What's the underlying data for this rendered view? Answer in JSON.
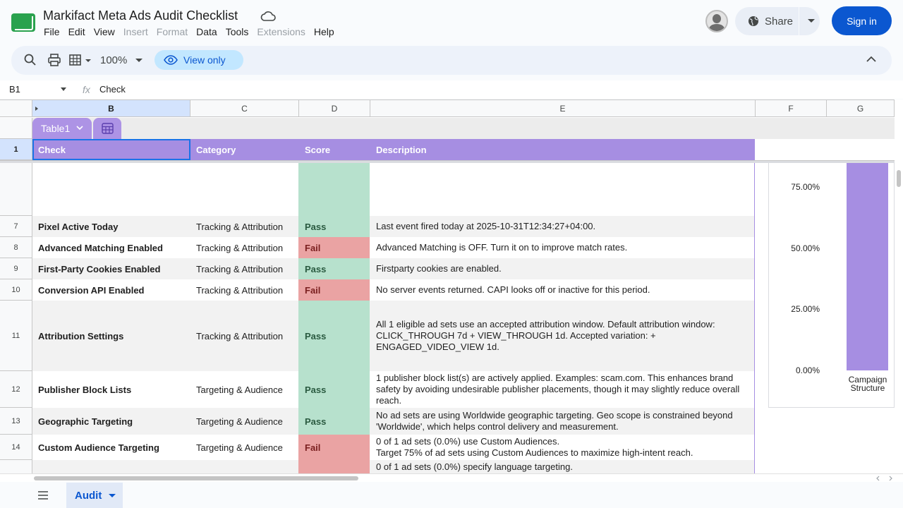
{
  "app": {
    "doc_title": "Markifact Meta Ads Audit Checklist",
    "menu": [
      {
        "label": "File",
        "enabled": true
      },
      {
        "label": "Edit",
        "enabled": true
      },
      {
        "label": "View",
        "enabled": true
      },
      {
        "label": "Insert",
        "enabled": false
      },
      {
        "label": "Format",
        "enabled": false
      },
      {
        "label": "Data",
        "enabled": true
      },
      {
        "label": "Tools",
        "enabled": true
      },
      {
        "label": "Extensions",
        "enabled": false
      },
      {
        "label": "Help",
        "enabled": true
      }
    ],
    "share_label": "Share",
    "signin_label": "Sign in"
  },
  "toolbar": {
    "zoom": "100%",
    "view_only": "View only"
  },
  "formula_bar": {
    "name_box": "B1",
    "fx": "fx",
    "value": "Check"
  },
  "grid": {
    "columns": [
      "B",
      "C",
      "D",
      "E",
      "F",
      "G"
    ],
    "table_name": "Table1",
    "header_row_number": "1",
    "headers": {
      "check": "Check",
      "category": "Category",
      "score": "Score",
      "description": "Description"
    },
    "rows": [
      {
        "num": "",
        "check": "",
        "category": "",
        "score": "",
        "status": "pass",
        "description": ""
      },
      {
        "num": "7",
        "check": "Pixel Active Today",
        "category": "Tracking & Attribution",
        "score": "Pass",
        "status": "pass",
        "description": "Last event fired today at 2025-10-31T12:34:27+04:00."
      },
      {
        "num": "8",
        "check": "Advanced Matching Enabled",
        "category": "Tracking & Attribution",
        "score": "Fail",
        "status": "fail",
        "description": "Advanced Matching is OFF. Turn it on to improve match rates."
      },
      {
        "num": "9",
        "check": "First-Party Cookies Enabled",
        "category": "Tracking & Attribution",
        "score": "Pass",
        "status": "pass",
        "description": "Firstparty cookies are enabled."
      },
      {
        "num": "10",
        "check": "Conversion API Enabled",
        "category": "Tracking & Attribution",
        "score": "Fail",
        "status": "fail",
        "description": "No server events returned. CAPI looks off or inactive for this period."
      },
      {
        "num": "11",
        "check": "Attribution Settings",
        "category": "Tracking & Attribution",
        "score": "Pass",
        "status": "pass",
        "description": "All 1 eligible ad sets use an accepted attribution window. Default attribution window: CLICK_THROUGH 7d + VIEW_THROUGH 1d. Accepted variation: + ENGAGED_VIDEO_VIEW 1d."
      },
      {
        "num": "12",
        "check": "Publisher Block Lists",
        "category": "Targeting & Audience",
        "score": "Pass",
        "status": "pass",
        "description": "1 publisher block list(s) are actively applied. Examples: scam.com. This enhances brand safety by avoiding undesirable publisher placements, though it may slightly reduce overall reach."
      },
      {
        "num": "13",
        "check": "Geographic Targeting",
        "category": "Targeting & Audience",
        "score": "Pass",
        "status": "pass",
        "description": "No ad sets are using Worldwide geographic targeting. Geo scope is constrained beyond 'Worldwide', which helps control delivery and measurement."
      },
      {
        "num": "14",
        "check": "Custom Audience Targeting",
        "category": "Targeting & Audience",
        "score": "Fail",
        "status": "fail",
        "description": "0 of 1 ad sets (0.0%) use Custom Audiences.\nTarget 75% of ad sets using Custom Audiences to maximize high-intent reach."
      },
      {
        "num": "",
        "check": "",
        "category": "",
        "score": "",
        "status": "fail",
        "description": "0 of 1 ad sets (0.0%) specify language targeting."
      }
    ]
  },
  "chart_data": {
    "type": "bar",
    "categories": [
      "Campaign Structure"
    ],
    "values": [
      100
    ],
    "ytick_labels": [
      "75.00%",
      "50.00%",
      "25.00%",
      "0.00%"
    ],
    "ylim": [
      0,
      100
    ],
    "color": "#a68ee2"
  },
  "sheets": {
    "active": "Audit"
  }
}
